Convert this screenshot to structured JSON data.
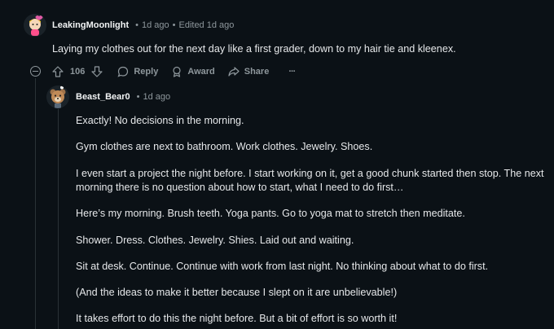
{
  "colors": {
    "background": "#0b1116",
    "text": "#e6e8ea",
    "muted": "#8e979c",
    "thread_line": "#2a3236"
  },
  "parent_comment": {
    "author": "LeakingMoonlight",
    "time": "1d ago",
    "edited": "Edited 1d ago",
    "body": "Laying my clothes out for the next day like a first grader, down to my hair tie and kleenex.",
    "vote_count": "106",
    "actions": {
      "reply": "Reply",
      "award": "Award",
      "share": "Share",
      "more": "···"
    }
  },
  "reply_comment": {
    "author": "Beast_Bear0",
    "time": "1d ago",
    "paragraphs": [
      "Exactly! No decisions in the morning.",
      "Gym clothes are next to bathroom. Work clothes. Jewelry. Shoes.",
      "I even start a project the night before. I start working on it, get a good chunk started then stop. The next morning there is no question about how to start, what I need to do first…",
      "Here’s my morning. Brush teeth. Yoga pants. Go to yoga mat to stretch then meditate.",
      "Shower. Dress. Clothes. Jewelry. Shies. Laid out and waiting.",
      "Sit at desk. Continue. Continue with work from last night. No thinking about what to do first.",
      "(And the ideas to make it better because I slept on it are unbelievable!)",
      "It takes effort to do this the night before. But a bit of effort is so worth it!"
    ]
  }
}
